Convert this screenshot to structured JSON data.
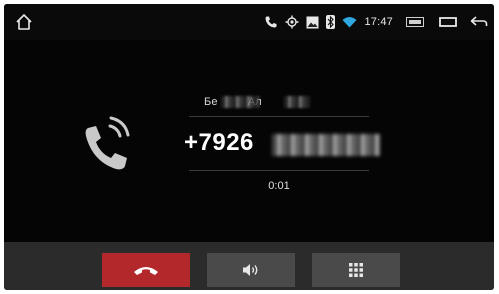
{
  "status_bar": {
    "home_icon": "home-icon",
    "icons": [
      "phone-call-icon",
      "gps-icon",
      "image-icon",
      "bluetooth-icon",
      "wifi-icon"
    ],
    "time": "17:47",
    "right_icons": [
      "window-icon",
      "recent-apps-icon",
      "back-icon"
    ]
  },
  "call": {
    "caller_name": "Бе",
    "caller_name_mid": "Ал",
    "number_prefix": "+7926",
    "duration": "0:01",
    "icon": "phone-ringing-icon"
  },
  "controls": {
    "hangup_icon": "hang-up-icon",
    "speaker_icon": "speaker-icon",
    "keypad_icon": "keypad-icon"
  },
  "colors": {
    "background": "#050505",
    "control_bar": "#2b2b2b",
    "hangup": "#b3282a",
    "button": "#4a4a4a",
    "accent_wifi": "#2fa8e0"
  }
}
